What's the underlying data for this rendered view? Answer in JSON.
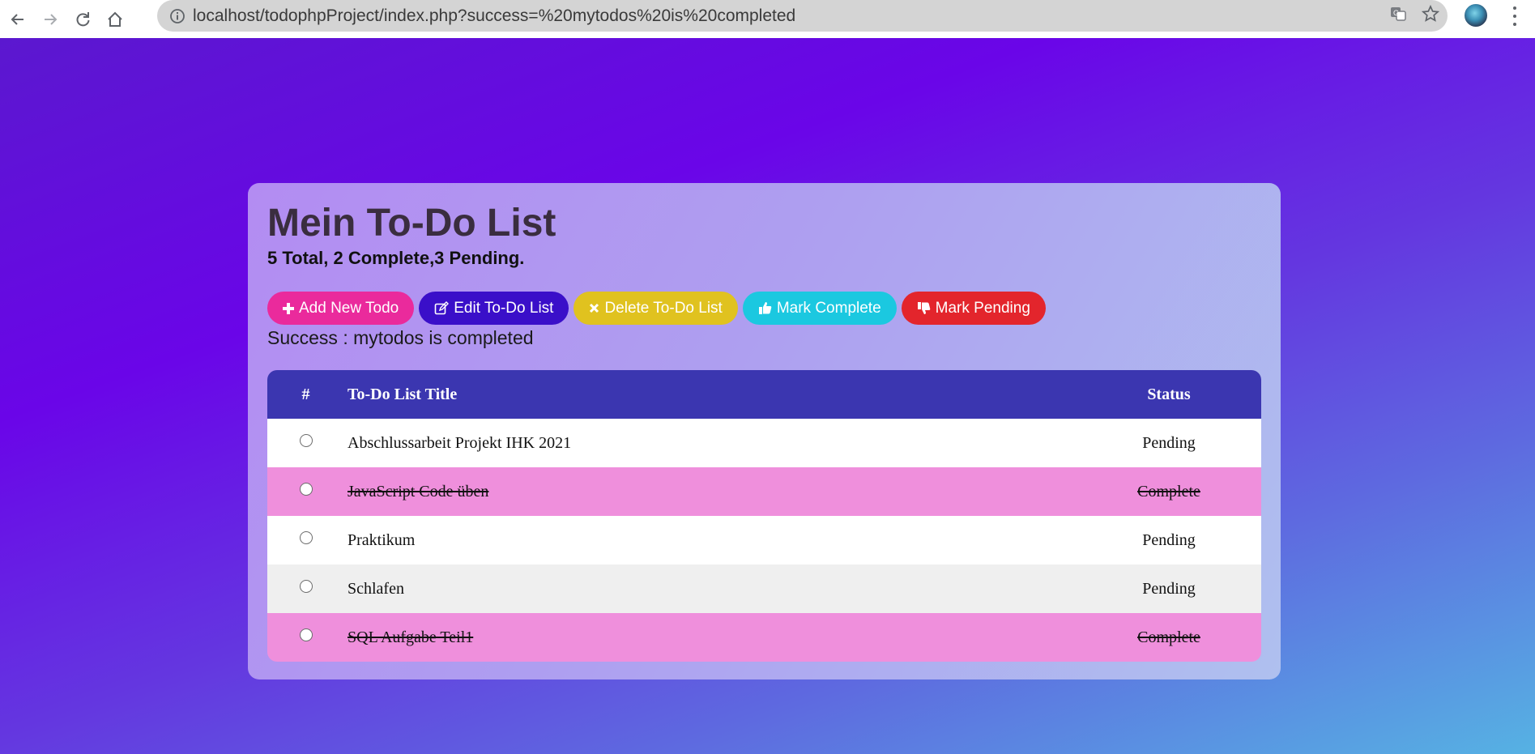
{
  "browser": {
    "url": "localhost/todophpProject/index.php?success=%20mytodos%20is%20completed",
    "icons": [
      "back-arrow-icon",
      "forward-arrow-icon",
      "reload-icon",
      "home-icon",
      "info-icon",
      "translate-icon",
      "star-icon",
      "avatar",
      "menu-kebab-icon"
    ]
  },
  "colors": {
    "add": "#ea2a9c",
    "edit": "#3a0fc9",
    "delete": "#e0c21f",
    "mark_complete": "#1bc8e0",
    "mark_pending": "#e3252c",
    "table_header": "#3b36b0",
    "row_complete": "#ef8fdc",
    "row_white": "#ffffff",
    "row_grey": "#efefef"
  },
  "card": {
    "title": "Mein To-Do List",
    "summary": "5 Total, 2 Complete,3 Pending."
  },
  "buttons": {
    "add": {
      "label": "Add New Todo",
      "icon": "plus-icon"
    },
    "edit": {
      "label": "Edit To-Do List",
      "icon": "edit-icon"
    },
    "delete": {
      "label": "Delete To-Do List",
      "icon": "times-icon"
    },
    "complete": {
      "label": "Mark Complete",
      "icon": "thumbs-up-icon"
    },
    "pending": {
      "label": "Mark Pending",
      "icon": "thumbs-down-icon"
    }
  },
  "message": "Success : mytodos is completed",
  "table": {
    "headers": {
      "num": "#",
      "title": "To-Do List Title",
      "status": "Status"
    },
    "rows": [
      {
        "title": "Abschlussarbeit Projekt IHK 2021",
        "status": "Pending",
        "completed": false,
        "bg": "#ffffff"
      },
      {
        "title": "JavaScript Code üben",
        "status": "Complete",
        "completed": true,
        "bg": "#ef8fdc"
      },
      {
        "title": "Praktikum",
        "status": "Pending",
        "completed": false,
        "bg": "#ffffff"
      },
      {
        "title": "Schlafen",
        "status": "Pending",
        "completed": false,
        "bg": "#efefef"
      },
      {
        "title": "SQL Aufgabe Teil1",
        "status": "Complete",
        "completed": true,
        "bg": "#ef8fdc"
      }
    ]
  }
}
